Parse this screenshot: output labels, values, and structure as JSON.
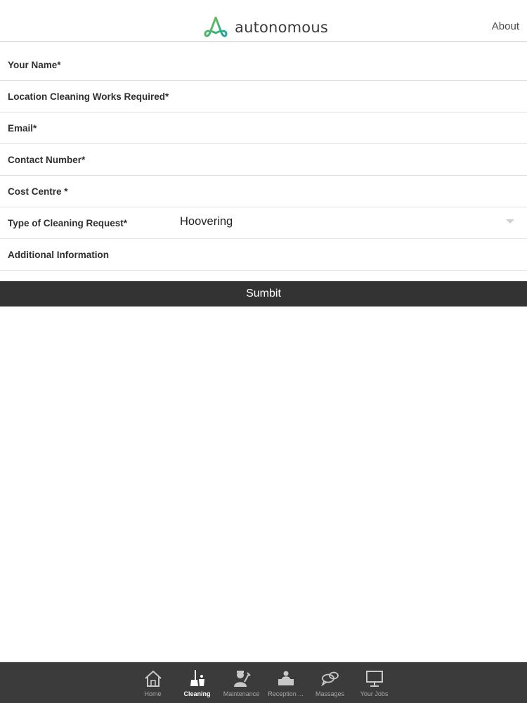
{
  "header": {
    "logo_text": "autonomous",
    "about_label": "About"
  },
  "form": {
    "fields": [
      {
        "label": "Your Name*",
        "value": ""
      },
      {
        "label": "Location Cleaning Works Required*",
        "value": ""
      },
      {
        "label": "Email*",
        "value": ""
      },
      {
        "label": "Contact Number*",
        "value": ""
      },
      {
        "label": "Cost Centre *",
        "value": ""
      },
      {
        "label": "Type of Cleaning Request*",
        "value": "Hoovering"
      },
      {
        "label": "Additional Information",
        "value": ""
      }
    ],
    "submit_label": "Sumbit"
  },
  "tabbar": {
    "items": [
      {
        "label": "Home",
        "icon": "home-icon",
        "active": false
      },
      {
        "label": "Cleaning",
        "icon": "cleaning-icon",
        "active": true
      },
      {
        "label": "Maintenance",
        "icon": "maintenance-icon",
        "active": false
      },
      {
        "label": "Reception ...",
        "icon": "reception-icon",
        "active": false
      },
      {
        "label": "Massages",
        "icon": "chat-icon",
        "active": false
      },
      {
        "label": "Your Jobs",
        "icon": "monitor-icon",
        "active": false
      }
    ]
  },
  "colors": {
    "logo_teal": "#1aa6a0",
    "logo_green": "#7cc242",
    "submit_bg": "#333333",
    "tabbar_bg": "#3b3b3b"
  }
}
